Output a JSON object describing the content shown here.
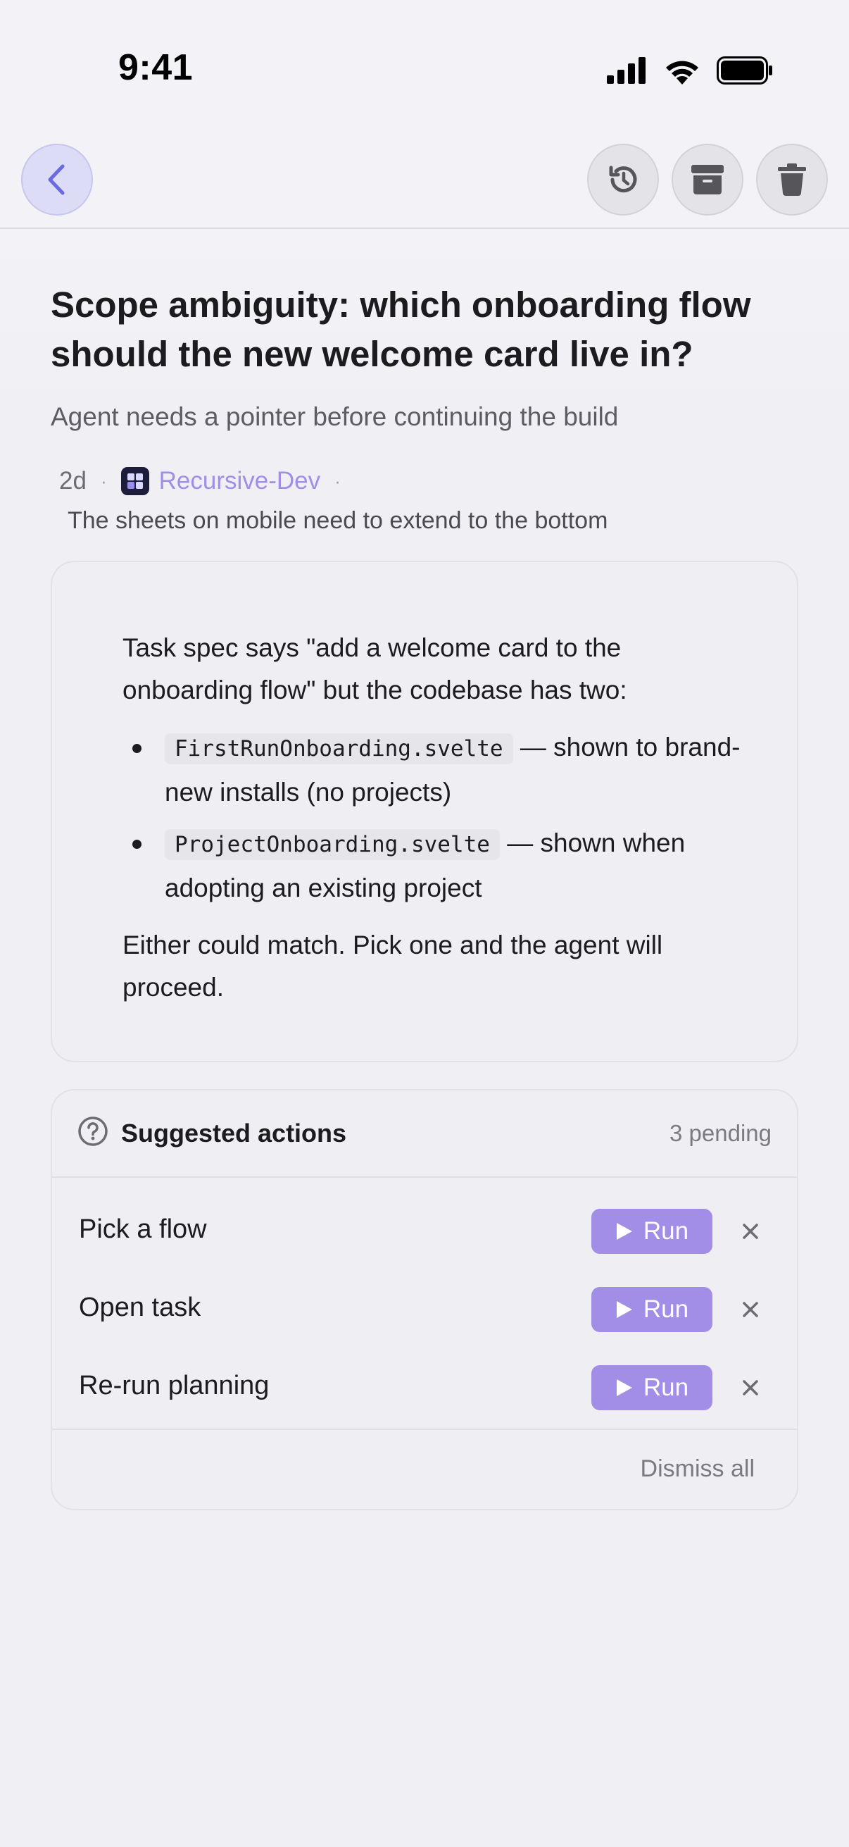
{
  "status_bar": {
    "time": "9:41"
  },
  "nav": {
    "back_icon": "chevron-left-icon",
    "actions": [
      "history-icon",
      "archive-icon",
      "trash-icon"
    ]
  },
  "header": {
    "title": "Scope ambiguity: which onboarding flow should the new welcome card live in?",
    "subtitle": "Agent needs a pointer before continuing the build"
  },
  "meta": {
    "age": "2d",
    "app_name": "Recursive-Dev",
    "preview": "The sheets on mobile need to extend to the bottom"
  },
  "card": {
    "intro": "Task spec says \"add a welcome card to the onboarding flow\" but the codebase has two:",
    "items": [
      {
        "code": "FirstRunOnboarding.svelte",
        "text": "— shown to brand-new installs (no projects)"
      },
      {
        "code": "ProjectOnboarding.svelte",
        "text": "— shown when adopting an existing project"
      }
    ],
    "outro": "Either could match. Pick one and the agent will proceed."
  },
  "actions": {
    "title": "Suggested actions",
    "count": "3 pending",
    "rows": [
      {
        "label": "Pick a flow",
        "run_label": "Run"
      },
      {
        "label": "Open task",
        "run_label": "Run"
      },
      {
        "label": "Re-run planning",
        "run_label": "Run"
      }
    ],
    "dismiss_all": "Dismiss all"
  },
  "colors": {
    "accent": "#a28ee6",
    "back_button": "#dcdcf6",
    "text": "#1c1c1e"
  }
}
